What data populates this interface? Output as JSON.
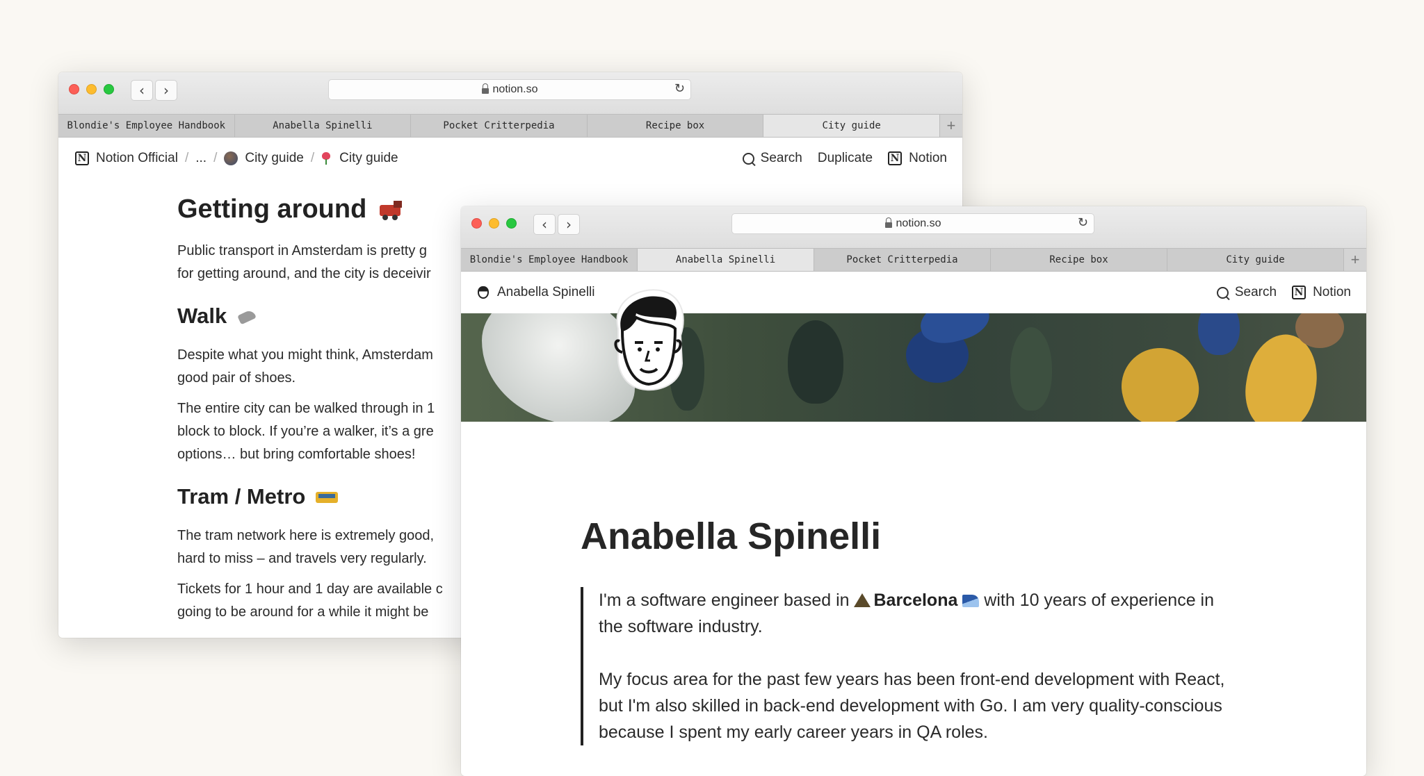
{
  "back_window": {
    "url": "notion.so",
    "tabs": [
      "Blondie's Employee Handbook",
      "Anabella Spinelli",
      "Pocket Critterpedia",
      "Recipe box",
      "City guide"
    ],
    "active_tab_index": 4,
    "breadcrumb": [
      "Notion Official",
      "...",
      "City guide",
      "City guide"
    ],
    "actions": {
      "search": "Search",
      "duplicate": "Duplicate",
      "notion": "Notion"
    },
    "content": {
      "heading": "Getting around",
      "intro": [
        "Public transport in Amsterdam is pretty g",
        "for getting around, and the city is deceivir"
      ],
      "walk_heading": "Walk",
      "walk_paragraphs": [
        [
          "Despite what you might think, Amsterdam",
          "good pair of shoes."
        ],
        [
          "The entire city can be walked through in 1",
          "block to block. If you’re a walker, it’s a gre",
          "options… but bring comfortable shoes!"
        ]
      ],
      "tram_heading": "Tram / Metro",
      "tram_paragraphs": [
        [
          "The tram network here is extremely good,",
          "hard to miss – and travels very regularly."
        ],
        [
          "Tickets for 1 hour and 1 day are available c",
          "going to be around for a while it might be"
        ]
      ]
    }
  },
  "front_window": {
    "url": "notion.so",
    "tabs": [
      "Blondie's Employee Handbook",
      "Anabella Spinelli",
      "Pocket Critterpedia",
      "Recipe box",
      "City guide"
    ],
    "active_tab_index": 1,
    "page_title_crumb": "Anabella Spinelli",
    "actions": {
      "search": "Search",
      "notion": "Notion"
    },
    "content": {
      "name": "Anabella Spinelli",
      "bio_1_a": "I'm a software engineer based in ",
      "bio_1_city": "Barcelona",
      "bio_1_b": " with 10 years of experience in the software industry.",
      "bio_2": "My focus area for the past few years has been front-end development with React, but I'm also skilled in back-end development with Go. I am very quality-conscious because I spent my early career years in QA roles."
    }
  },
  "icons": [
    "notion-logo-icon",
    "search-icon",
    "lock-icon",
    "reload-icon",
    "back-arrow-icon",
    "forward-arrow-icon",
    "train-icon",
    "sneaker-icon",
    "tram-icon",
    "tulip-icon",
    "globe-avatar-icon",
    "mountain-icon",
    "wave-icon",
    "avatar-illustration"
  ]
}
